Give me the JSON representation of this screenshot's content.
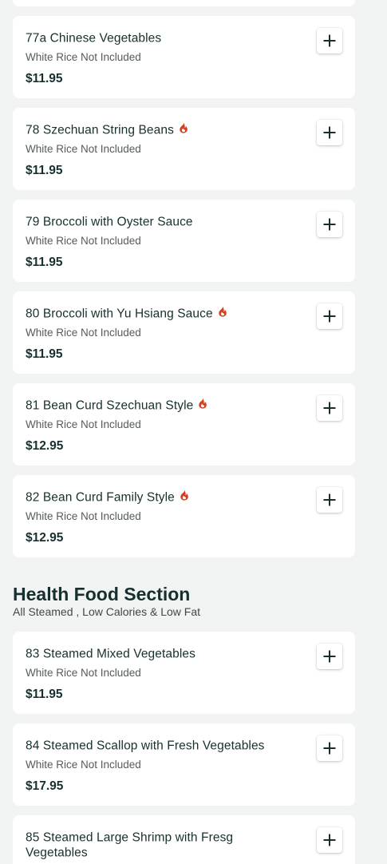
{
  "section_top": {},
  "items_top": [
    {
      "name": "77a Chinese Vegetables",
      "description": "White Rice Not Included",
      "price": "$11.95",
      "spicy": false
    },
    {
      "name": "78 Szechuan String Beans",
      "description": "White Rice Not Included",
      "price": "$11.95",
      "spicy": true
    },
    {
      "name": "79 Broccoli with Oyster Sauce",
      "description": "White Rice Not Included",
      "price": "$11.95",
      "spicy": false
    },
    {
      "name": "80 Broccoli with Yu Hsiang Sauce",
      "description": "White Rice Not Included",
      "price": "$11.95",
      "spicy": true
    },
    {
      "name": "81 Bean Curd Szechuan Style",
      "description": "White Rice Not Included",
      "price": "$12.95",
      "spicy": true
    },
    {
      "name": "82 Bean Curd Family Style",
      "description": "White Rice Not Included",
      "price": "$12.95",
      "spicy": true
    }
  ],
  "health_section": {
    "title": "Health Food Section",
    "subtitle": "All Steamed , Low Calories & Low Fat",
    "items": [
      {
        "name": "83 Steamed Mixed Vegetables",
        "description": "White Rice Not Included",
        "price": "$11.95",
        "spicy": false
      },
      {
        "name": "84 Steamed Scallop with Fresh Vegetables",
        "description": "White Rice Not Included",
        "price": "$17.95",
        "spicy": false
      },
      {
        "name": "85 Steamed Large Shrimp with Fresg Vegetables",
        "description": "",
        "price": "",
        "spicy": false
      }
    ]
  },
  "icons": {
    "add": "plus-icon",
    "spicy": "flame-icon"
  },
  "colors": {
    "background": "#f2f3f3",
    "card": "#ffffff",
    "text_primary": "#17302f",
    "text_secondary": "#555b5b",
    "spicy": "#d2401f"
  }
}
